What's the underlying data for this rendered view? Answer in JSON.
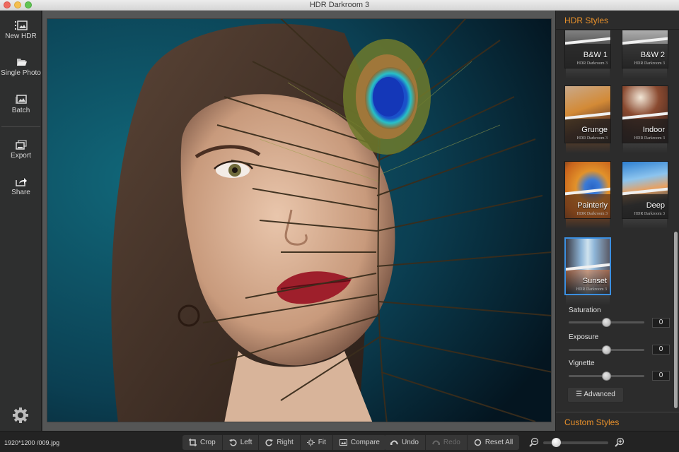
{
  "window": {
    "title": "HDR Darkroom 3"
  },
  "sidebar": {
    "items": [
      {
        "label": "New HDR",
        "icon": "new-hdr-icon"
      },
      {
        "label": "Single Photo",
        "icon": "folder-open-icon"
      },
      {
        "label": "Batch",
        "icon": "batch-icon"
      },
      {
        "label": "Export",
        "icon": "export-icon"
      },
      {
        "label": "Share",
        "icon": "share-icon"
      }
    ],
    "settings_icon": "gear-icon"
  },
  "photo": {
    "description": "Portrait of woman with peacock feather over face, teal background"
  },
  "right_panel": {
    "styles_heading": "HDR Styles",
    "custom_heading": "Custom Styles",
    "styles": [
      {
        "label": "B&W 1",
        "sub": "HDR Darkroom 3",
        "selected": false
      },
      {
        "label": "B&W 2",
        "sub": "HDR Darkroom 3",
        "selected": false
      },
      {
        "label": "Grunge",
        "sub": "HDR Darkroom 3",
        "selected": false
      },
      {
        "label": "Indoor",
        "sub": "HDR Darkroom 3",
        "selected": false
      },
      {
        "label": "Painterly",
        "sub": "HDR Darkroom 3",
        "selected": false
      },
      {
        "label": "Deep",
        "sub": "HDR Darkroom 3",
        "selected": false
      },
      {
        "label": "Sunset",
        "sub": "HDR Darkroom 3",
        "selected": true
      }
    ],
    "sliders": [
      {
        "label": "Saturation",
        "value": "0",
        "position": 0.5
      },
      {
        "label": "Exposure",
        "value": "0",
        "position": 0.5
      },
      {
        "label": "Vignette",
        "value": "0",
        "position": 0.5
      }
    ],
    "advanced_label": "Advanced"
  },
  "bottom_bar": {
    "file_info": "1920*1200 /009.jpg",
    "tools": [
      {
        "label": "Crop",
        "icon": "crop-icon"
      },
      {
        "label": "Left",
        "icon": "rotate-left-icon"
      },
      {
        "label": "Right",
        "icon": "rotate-right-icon"
      },
      {
        "label": "Fit",
        "icon": "fit-icon"
      },
      {
        "label": "Compare",
        "icon": "compare-icon"
      }
    ],
    "history": [
      {
        "label": "Undo",
        "icon": "undo-icon",
        "enabled": true
      },
      {
        "label": "Redo",
        "icon": "redo-icon",
        "enabled": false
      },
      {
        "label": "Reset All",
        "icon": "reset-icon",
        "enabled": true
      }
    ],
    "zoom_level": 0.2
  }
}
